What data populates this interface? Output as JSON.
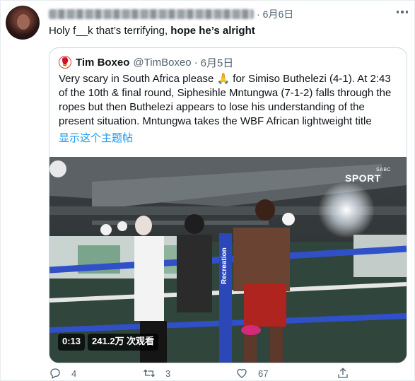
{
  "tweet": {
    "author_name_blurred": true,
    "date": "6月6日",
    "text_plain": "Holy f__k that’s terrifying, ",
    "text_bold": "hope he’s alright",
    "more_icon": "more-horizontal-icon"
  },
  "quoted": {
    "avatar_emoji": "🥊",
    "name": "Tim Boxeo",
    "handle": "@TimBoxeo",
    "dot": "·",
    "date": "6月5日",
    "text": "Very scary in South Africa please 🙏 for Simiso Buthelezi (4-1). At 2:43 of the 10th & final round, Siphesihle Mntungwa (7-1-2) falls through the ropes but then Buthelezi appears to lose his understanding of the present situation. Mntungwa takes the WBF African lightweight title",
    "show_thread": "显示这个主题帖",
    "video": {
      "time": "0:13",
      "views": "241.2万 次观看",
      "logo": "SPORT",
      "logo_small": "SABC",
      "ring_text": "Recreation"
    }
  },
  "actions": {
    "reply_count": "4",
    "retweet_count": "3",
    "like_count": "67"
  },
  "colors": {
    "text": "#0f1419",
    "secondary": "#536471",
    "link": "#1d9bf0",
    "border": "#cfd9de"
  }
}
